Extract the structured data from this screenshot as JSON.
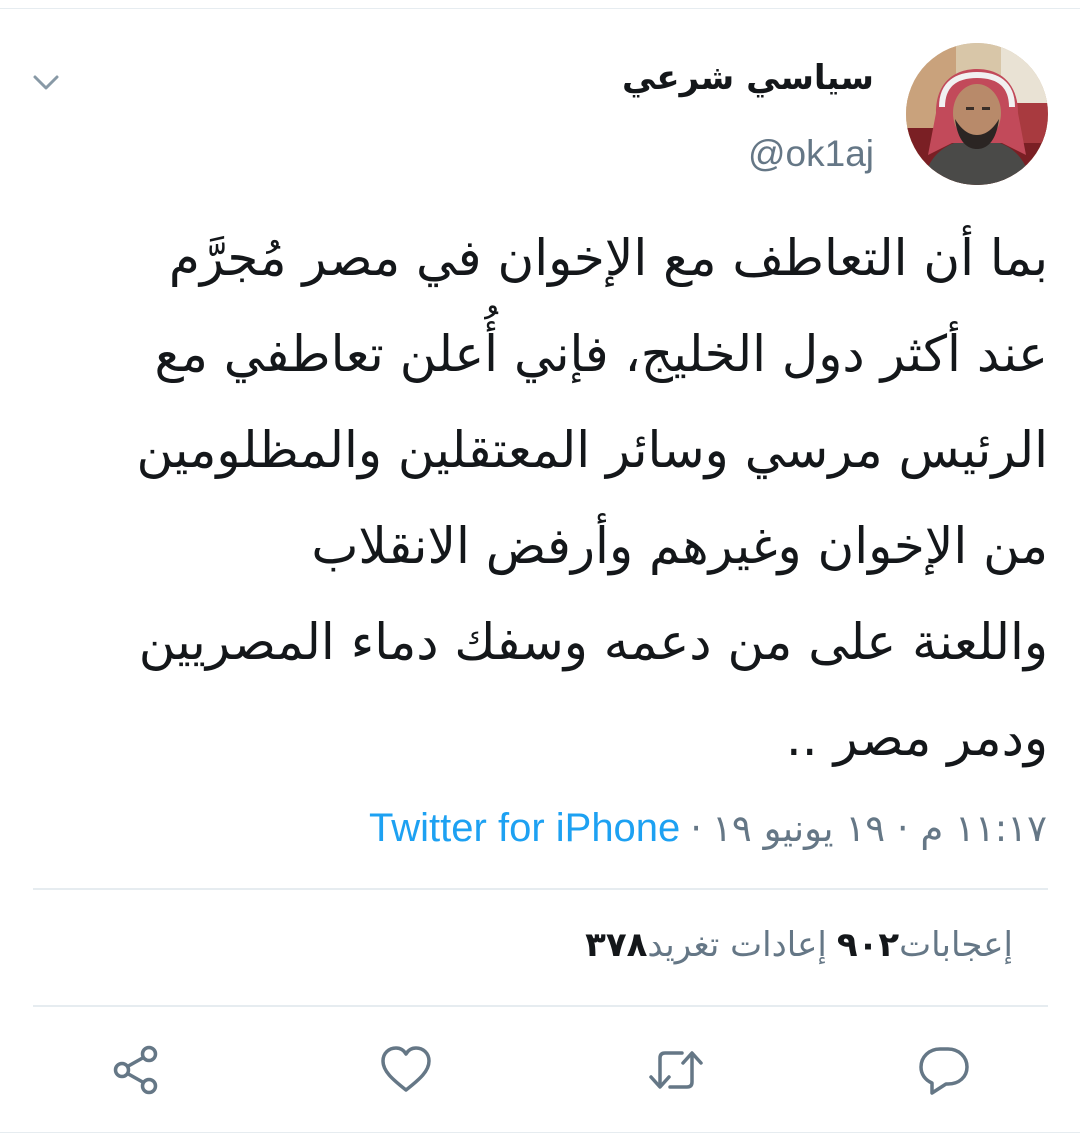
{
  "tweet": {
    "display_name": "سياسي شرعي",
    "handle": "@ok1aj",
    "text_lines": [
      "بما أن التعاطف مع الإخوان في مصر مُجرَّم",
      "عند أكثر دول الخليج، فإني أُعلن تعاطفي مع",
      "الرئيس مرسي وسائر المعتقلين والمظلومين",
      "من الإخوان وغيرهم وأرفض الانقلاب",
      "واللعنة على من دعمه وسفك دماء المصريين",
      "ودمر مصر .."
    ],
    "timestamp": "١١:١٧ م · ١٩ يونيو ١٩",
    "separator": "·",
    "source": "Twitter for iPhone"
  },
  "stats": {
    "retweets_count": "٣٧٨",
    "retweets_label": "إعادات تغريد",
    "likes_count": "٩٠٢",
    "likes_label": "إعجابات"
  },
  "icons": {
    "more": "chevron-down-icon",
    "reply": "reply-icon",
    "retweet": "retweet-icon",
    "like": "heart-icon",
    "share": "share-icon"
  },
  "colors": {
    "text": "#14171a",
    "secondary": "#657786",
    "link": "#1da1f2",
    "divider": "#e6ecf0"
  }
}
